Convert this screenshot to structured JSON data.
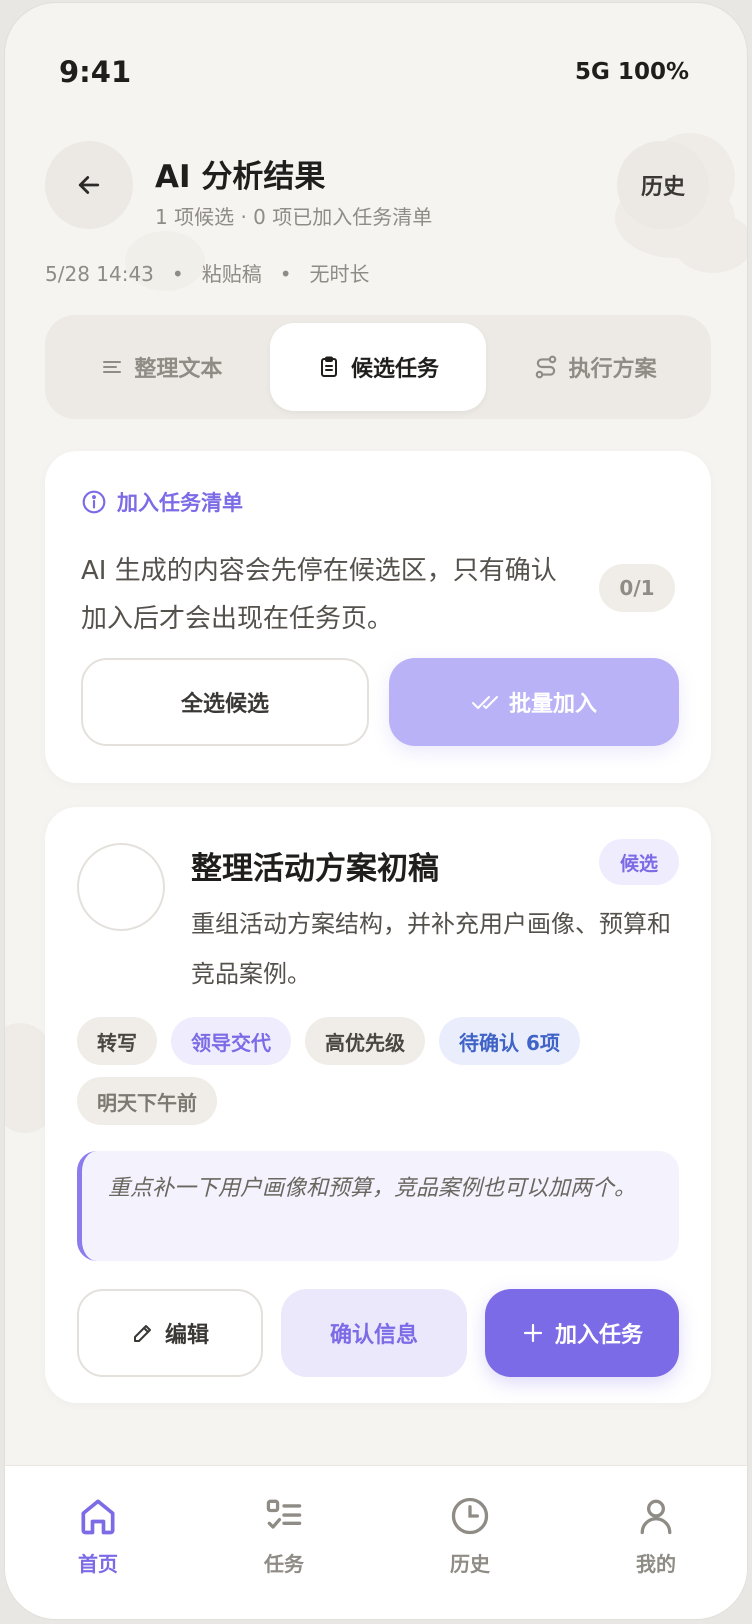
{
  "status": {
    "time": "9:41",
    "network": "5G 100%"
  },
  "header": {
    "title": "AI 分析结果",
    "subtitle": "1 项候选 · 0 项已加入任务清单",
    "history_label": "历史",
    "meta": {
      "time": "5/28 14:43",
      "source": "粘贴稿",
      "duration": "无时长",
      "separator": "•"
    }
  },
  "tabs": [
    {
      "label": "整理文本",
      "icon": "lines-icon"
    },
    {
      "label": "候选任务",
      "icon": "clipboard-icon",
      "active": true
    },
    {
      "label": "执行方案",
      "icon": "flow-icon"
    }
  ],
  "info_card": {
    "heading": "加入任务清单",
    "text": "AI 生成的内容会先停在候选区，只有确认加入后才会出现在任务页。",
    "count": "0/1",
    "select_all_label": "全选候选",
    "batch_add_label": "批量加入"
  },
  "task": {
    "title": "整理活动方案初稿",
    "badge": "候选",
    "description": "重组活动方案结构，并补充用户画像、预算和竞品案例。",
    "tags": [
      "转写",
      "领导交代",
      "高优先级",
      "待确认 6项",
      "明天下午前"
    ],
    "note": "重点补一下用户画像和预算，竞品案例也可以加两个。",
    "edit_label": "编辑",
    "confirm_label": "确认信息",
    "add_label": "加入任务"
  },
  "nav": [
    {
      "label": "首页",
      "icon": "home-icon",
      "active": true
    },
    {
      "label": "任务",
      "icon": "task-list-icon"
    },
    {
      "label": "历史",
      "icon": "clock-icon"
    },
    {
      "label": "我的",
      "icon": "user-icon"
    }
  ],
  "colors": {
    "accent": "#7b6be6",
    "background": "#f6f4f0",
    "card": "#ffffff"
  }
}
